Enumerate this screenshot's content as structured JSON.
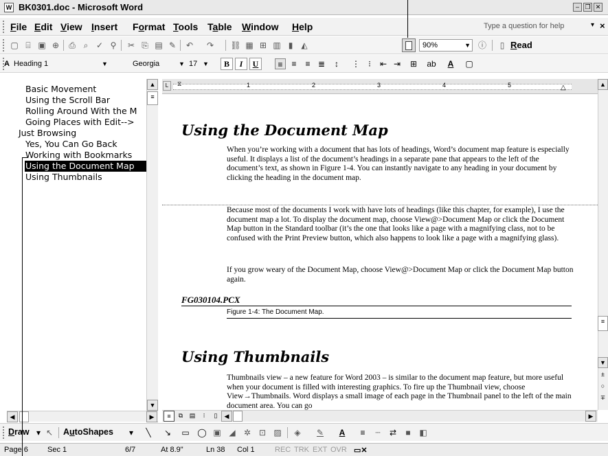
{
  "window": {
    "title": "BK0301.doc - Microsoft Word",
    "app_icon": "W",
    "controls": {
      "minimize": "–",
      "restore": "❐",
      "close": "✕"
    }
  },
  "menubar": {
    "items": [
      "File",
      "Edit",
      "View",
      "Insert",
      "Format",
      "Tools",
      "Table",
      "Window",
      "Help"
    ],
    "help_placeholder": "Type a question for help",
    "dropdown": "▾",
    "close": "×"
  },
  "standard_toolbar": {
    "zoom": "90%",
    "read_label": "Read",
    "pilcrow": "¶"
  },
  "formatting_toolbar": {
    "style": "Heading 1",
    "font": "Georgia",
    "size": "17",
    "bold": "B",
    "italic": "I",
    "underline": "U"
  },
  "document_map": {
    "items": [
      "Basic Movement",
      "Using the Scroll Bar",
      "Rolling Around With the M",
      "Going Places with Edit-->",
      "Just Browsing",
      "Yes, You Can Go Back",
      "Working with Bookmarks",
      "Using the Document Map",
      "Using Thumbnails"
    ],
    "selected_index": 7
  },
  "ruler": {
    "numbers": [
      "1",
      "2",
      "3",
      "4",
      "5"
    ]
  },
  "document": {
    "heading1": "Using the Document Map",
    "para1": "When you’re working with a document that has lots of headings, Word’s document map feature is especially useful. It displays a list of the document’s headings in a separate pane that appears to the left of the document’s text, as shown in Figure 1-4. You can instantly navigate to any heading in your document by clicking the heading in the document map.",
    "para2": "Because most of the documents I work with have lots of headings (like this chapter, for example), I use the document map a lot. To display the document map, choose View@>Document Map or click the Document Map button in the Standard toolbar (it’s the one that looks like a page with a magnifying class, not to be confused with the Print Preview button, which also happens to look like a page with a magnifying glass).",
    "para3": "If you grow weary of the Document Map, choose View@>Document Map or click the Document Map button again.",
    "figure_ref": "FG030104.PCX",
    "figure_caption": "Figure 1-4: The Document Map.",
    "heading2": "Using Thumbnails",
    "para4": "Thumbnails view – a new feature for Word 2003 – is similar to the document map feature, but more useful when your document is filled with interesting graphics. To fire up the Thumbnail view, choose View→Thumbnails. Word displays a small image of each page in the Thumbnail panel to the left of the main document area. You can go"
  },
  "drawing_toolbar": {
    "draw": "Draw",
    "autoshapes": "AutoShapes"
  },
  "statusbar": {
    "page": "Page 6",
    "sec": "Sec 1",
    "pages": "6/7",
    "at": "At 8.9\"",
    "ln": "Ln 38",
    "col": "Col 1",
    "rec": "REC",
    "trk": "TRK",
    "ext": "EXT",
    "ovr": "OVR"
  }
}
